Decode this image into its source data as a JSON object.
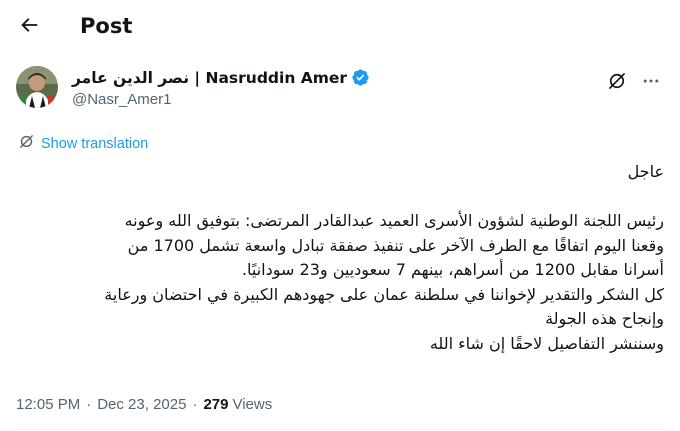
{
  "header": {
    "title": "Post"
  },
  "author": {
    "display_name": "نصر الدين عامر | Nasruddin Amer",
    "handle": "@Nasr_Amer1"
  },
  "translate": {
    "label": "Show translation"
  },
  "tweet": {
    "line1": "عاجل",
    "line2": "رئيس اللجنة الوطنية لشؤون الأسرى العميد عبدالقادر المرتضى: بتوفيق الله وعونه",
    "line3": "وقعنا اليوم اتفاقًا مع الطرف الآخر على تنفيذ صفقة تبادل واسعة تشمل 1700 من",
    "line4": "أسرانا مقابل 1200 من أسراهم، بينهم 7 سعوديين و23 سودانيًا.",
    "line5": "كل الشكر والتقدير لإخواننا في سلطنة عمان على جهودهم الكبيرة في احتضان ورعاية",
    "line6": "وإنجاح هذه الجولة",
    "line7": "وسننشر التفاصيل لاحقًا إن شاء الله"
  },
  "meta": {
    "time": "12:05 PM",
    "separator": "·",
    "date": "Dec 23, 2025",
    "views_count": "279",
    "views_label": "Views"
  },
  "colors": {
    "accent": "#1d9bf0",
    "secondary_text": "#536471",
    "primary_text": "#0f1419"
  }
}
